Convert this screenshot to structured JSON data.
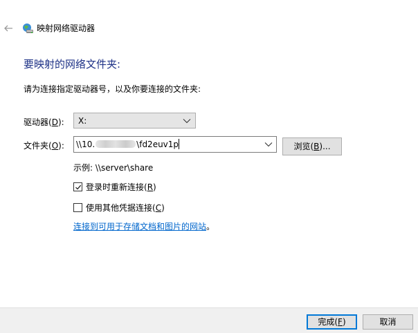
{
  "window": {
    "title": "映射网络驱动器",
    "back_icon": "back-arrow-icon",
    "app_icon": "network-drive-icon"
  },
  "main": {
    "heading": "要映射的网络文件夹:",
    "instruction": "请为连接指定驱动器号，以及你要连接的文件夹:",
    "drive_label_pre": "驱动器(",
    "drive_label_key": "D",
    "drive_label_post": "):",
    "drive_value": "X:",
    "folder_label_pre": "文件夹(",
    "folder_label_key": "O",
    "folder_label_post": "):",
    "folder_value_prefix": "\\\\10.",
    "folder_value_suffix": "\\fd2euv1p",
    "browse_pre": "浏览(",
    "browse_key": "B",
    "browse_post": ")...",
    "example": "示例: \\\\server\\share",
    "reconnect_pre": "登录时重新连接(",
    "reconnect_key": "R",
    "reconnect_post": ")",
    "reconnect_checked": true,
    "other_cred_pre": "使用其他凭据连接(",
    "other_cred_key": "C",
    "other_cred_post": ")",
    "other_cred_checked": false,
    "link_text": "连接到可用于存储文档和图片的网站",
    "link_tail": "。"
  },
  "footer": {
    "finish_pre": "完成(",
    "finish_key": "F",
    "finish_post": ")",
    "cancel": "取消"
  },
  "colors": {
    "heading": "#1e3287",
    "link": "#0066cc",
    "accent": "#0078d7"
  }
}
